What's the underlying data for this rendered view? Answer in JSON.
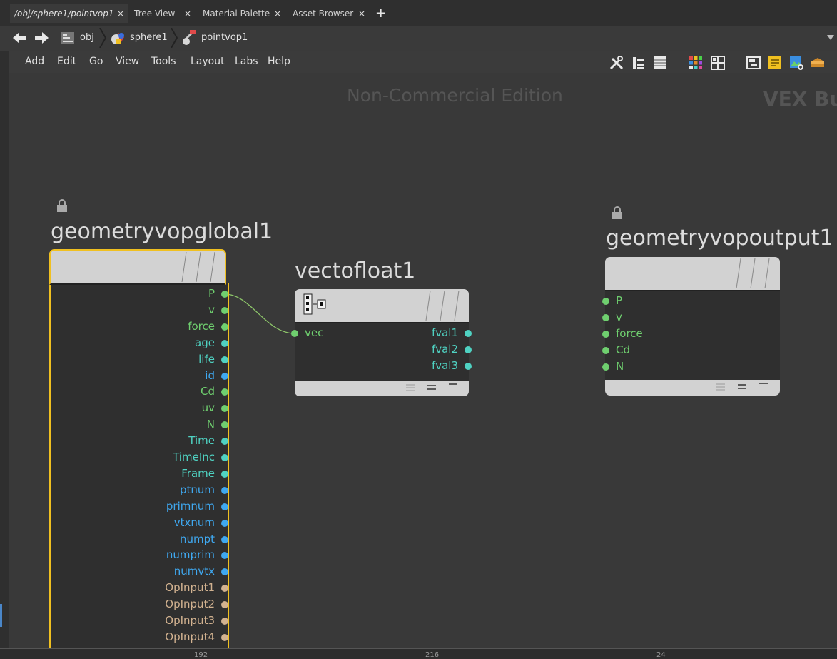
{
  "tabs": [
    {
      "label": "/obj/sphere1/pointvop1",
      "close": "×"
    },
    {
      "label": "Tree View",
      "close": "×"
    },
    {
      "label": "Material Palette",
      "close": "×"
    },
    {
      "label": "Asset Browser",
      "close": "×"
    }
  ],
  "tab_add": "+",
  "breadcrumbs": [
    "obj",
    "sphere1",
    "pointvop1"
  ],
  "menu": [
    "Add",
    "Edit",
    "Go",
    "View",
    "Tools",
    "Layout",
    "Labs",
    "Help"
  ],
  "toolbar_icons": [
    "wrench-icon",
    "tree-icon",
    "list-icon",
    "grid-color-icon",
    "grid-icon",
    "network-box-icon",
    "sticky-note-icon",
    "image-add-icon",
    "subnet-icon"
  ],
  "canvas": {
    "watermark": "Non-Commercial Edition",
    "context_label": "VEX Bui"
  },
  "nodes": {
    "global": {
      "title": "geometryvopglobal1",
      "outputs": [
        {
          "label": "P",
          "color": "#6fcf6f"
        },
        {
          "label": "v",
          "color": "#6fcf6f"
        },
        {
          "label": "force",
          "color": "#6fcf6f"
        },
        {
          "label": "age",
          "color": "#4fd2c2"
        },
        {
          "label": "life",
          "color": "#4fd2c2"
        },
        {
          "label": "id",
          "color": "#3fa8f0"
        },
        {
          "label": "Cd",
          "color": "#6fcf6f"
        },
        {
          "label": "uv",
          "color": "#6fcf6f"
        },
        {
          "label": "N",
          "color": "#6fcf6f"
        },
        {
          "label": "Time",
          "color": "#4fd2c2"
        },
        {
          "label": "TimeInc",
          "color": "#4fd2c2"
        },
        {
          "label": "Frame",
          "color": "#4fd2c2"
        },
        {
          "label": "ptnum",
          "color": "#3fa8f0"
        },
        {
          "label": "primnum",
          "color": "#3fa8f0"
        },
        {
          "label": "vtxnum",
          "color": "#3fa8f0"
        },
        {
          "label": "numpt",
          "color": "#3fa8f0"
        },
        {
          "label": "numprim",
          "color": "#3fa8f0"
        },
        {
          "label": "numvtx",
          "color": "#3fa8f0"
        },
        {
          "label": "OpInput1",
          "color": "#d2b290"
        },
        {
          "label": "OpInput2",
          "color": "#d2b290"
        },
        {
          "label": "OpInput3",
          "color": "#d2b290"
        },
        {
          "label": "OpInput4",
          "color": "#d2b290"
        }
      ]
    },
    "vectofloat": {
      "title": "vectofloat1",
      "inputs": [
        {
          "label": "vec",
          "color": "#6fcf6f"
        }
      ],
      "outputs": [
        {
          "label": "fval1",
          "color": "#4fd2c2"
        },
        {
          "label": "fval2",
          "color": "#4fd2c2"
        },
        {
          "label": "fval3",
          "color": "#4fd2c2"
        }
      ]
    },
    "output": {
      "title": "geometryvopoutput1",
      "inputs": [
        {
          "label": "P",
          "color": "#6fcf6f"
        },
        {
          "label": "v",
          "color": "#6fcf6f"
        },
        {
          "label": "force",
          "color": "#6fcf6f"
        },
        {
          "label": "Cd",
          "color": "#6fcf6f"
        },
        {
          "label": "N",
          "color": "#6fcf6f"
        }
      ]
    }
  },
  "ruler": [
    "192",
    "216",
    "24"
  ],
  "colors": {
    "accent_selected": "#f0c020",
    "wire": "#8ec66a"
  }
}
